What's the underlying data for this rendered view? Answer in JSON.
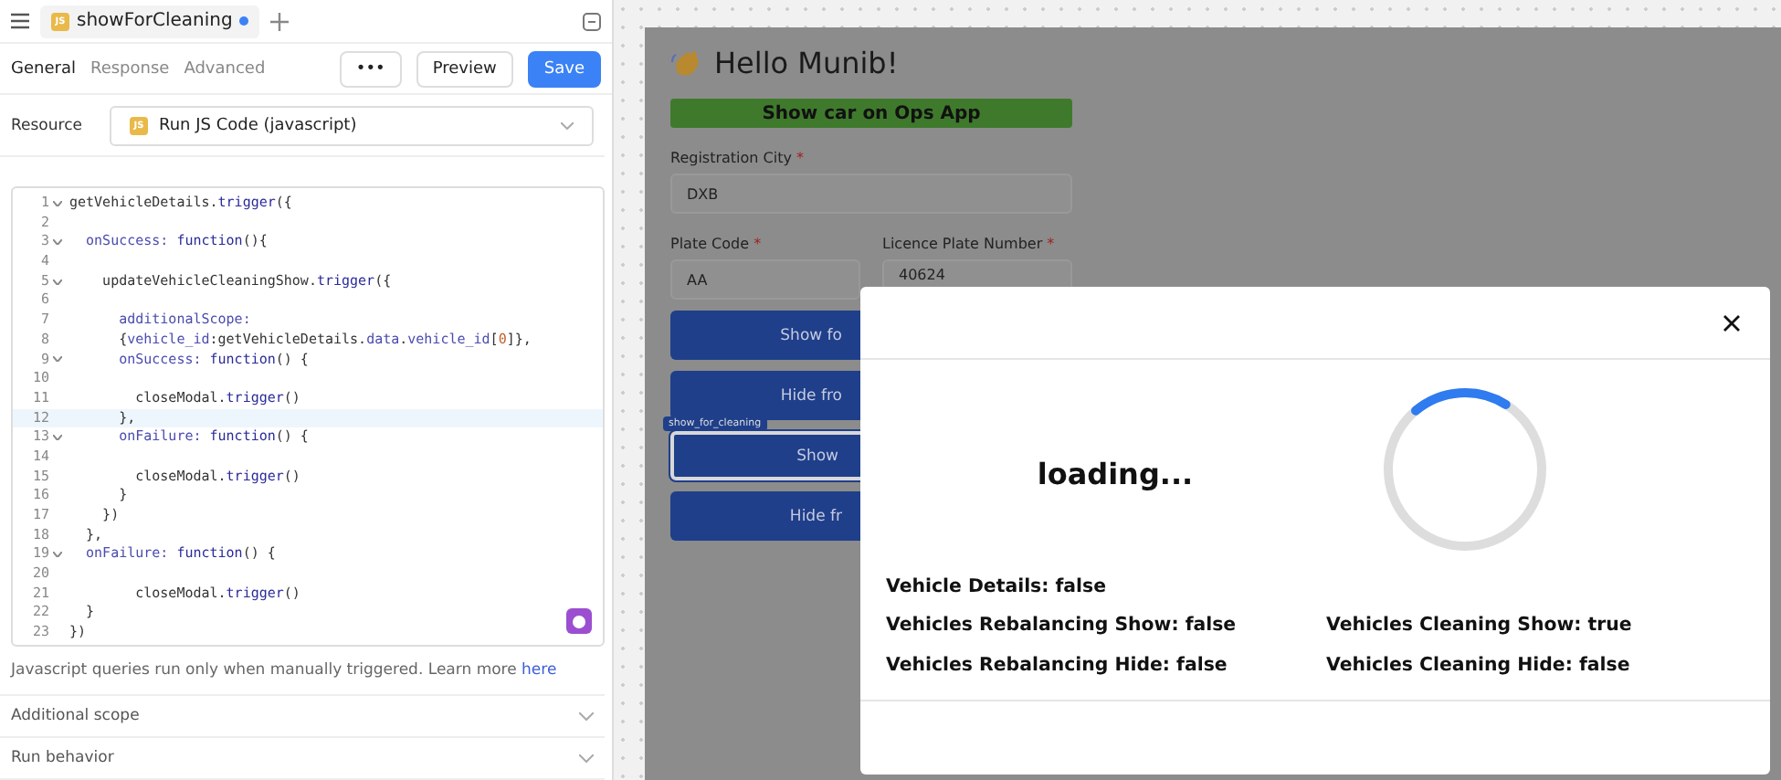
{
  "editor": {
    "tab": {
      "badge": "JS",
      "title": "showForCleaning",
      "unsaved": true
    },
    "subtabs": [
      {
        "label": "General",
        "selected": true
      },
      {
        "label": "Response",
        "selected": false
      },
      {
        "label": "Advanced",
        "selected": false
      }
    ],
    "more_button": "•••",
    "preview_button": "Preview",
    "save_button": "Save",
    "resource": {
      "label": "Resource",
      "badge": "JS",
      "value": "Run JS Code (javascript)"
    },
    "code_lines": [
      {
        "number": "1",
        "foldable": true,
        "selected": false,
        "tokens": [
          {
            "text": "getVehicleDetails.",
            "kind": "ident"
          },
          {
            "text": "trigger",
            "kind": "keyword"
          },
          {
            "text": "({",
            "kind": "ident"
          }
        ]
      },
      {
        "number": "2",
        "foldable": false,
        "selected": false
      },
      {
        "number": "3",
        "foldable": true,
        "selected": false,
        "tokens": [
          {
            "text": "  onSuccess: ",
            "kind": "prop"
          },
          {
            "text": "function",
            "kind": "keyword"
          },
          {
            "text": "(){",
            "kind": "ident"
          }
        ]
      },
      {
        "number": "4",
        "foldable": false,
        "selected": false
      },
      {
        "number": "5",
        "foldable": true,
        "selected": false,
        "tokens": [
          {
            "text": "    updateVehicleCleaningShow.",
            "kind": "ident"
          },
          {
            "text": "trigger",
            "kind": "keyword"
          },
          {
            "text": "({",
            "kind": "ident"
          }
        ]
      },
      {
        "number": "6",
        "foldable": false,
        "selected": false
      },
      {
        "number": "7",
        "foldable": false,
        "selected": false,
        "tokens": [
          {
            "text": "      additionalScope:",
            "kind": "prop"
          }
        ]
      },
      {
        "number": "8",
        "foldable": false,
        "selected": false,
        "tokens": [
          {
            "text": "      {",
            "kind": "ident"
          },
          {
            "text": "vehicle_id",
            "kind": "prop"
          },
          {
            "text": ":getVehicleDetails.",
            "kind": "ident"
          },
          {
            "text": "data",
            "kind": "prop"
          },
          {
            "text": ".",
            "kind": "ident"
          },
          {
            "text": "vehicle_id",
            "kind": "prop"
          },
          {
            "text": "[",
            "kind": "ident"
          },
          {
            "text": "0",
            "kind": "num"
          },
          {
            "text": "]},",
            "kind": "ident"
          }
        ]
      },
      {
        "number": "9",
        "foldable": true,
        "selected": false,
        "tokens": [
          {
            "text": "      onSuccess: ",
            "kind": "prop"
          },
          {
            "text": "function",
            "kind": "keyword"
          },
          {
            "text": "() {",
            "kind": "ident"
          }
        ]
      },
      {
        "number": "10",
        "foldable": false,
        "selected": false
      },
      {
        "number": "11",
        "foldable": false,
        "selected": false,
        "tokens": [
          {
            "text": "        closeModal.",
            "kind": "ident"
          },
          {
            "text": "trigger",
            "kind": "keyword"
          },
          {
            "text": "()",
            "kind": "ident"
          }
        ]
      },
      {
        "number": "12",
        "foldable": false,
        "selected": true,
        "tokens": [
          {
            "text": "      },",
            "kind": "ident"
          }
        ]
      },
      {
        "number": "13",
        "foldable": true,
        "selected": false,
        "tokens": [
          {
            "text": "      onFailure: ",
            "kind": "prop"
          },
          {
            "text": "function",
            "kind": "keyword"
          },
          {
            "text": "() {",
            "kind": "ident"
          }
        ]
      },
      {
        "number": "14",
        "foldable": false,
        "selected": false
      },
      {
        "number": "15",
        "foldable": false,
        "selected": false,
        "tokens": [
          {
            "text": "        closeModal.",
            "kind": "ident"
          },
          {
            "text": "trigger",
            "kind": "keyword"
          },
          {
            "text": "()",
            "kind": "ident"
          }
        ]
      },
      {
        "number": "16",
        "foldable": false,
        "selected": false,
        "tokens": [
          {
            "text": "      }",
            "kind": "ident"
          }
        ]
      },
      {
        "number": "17",
        "foldable": false,
        "selected": false,
        "tokens": [
          {
            "text": "    })",
            "kind": "ident"
          }
        ]
      },
      {
        "number": "18",
        "foldable": false,
        "selected": false,
        "tokens": [
          {
            "text": "  },",
            "kind": "ident"
          }
        ]
      },
      {
        "number": "19",
        "foldable": true,
        "selected": false,
        "tokens": [
          {
            "text": "  onFailure: ",
            "kind": "prop"
          },
          {
            "text": "function",
            "kind": "keyword"
          },
          {
            "text": "() {",
            "kind": "ident"
          }
        ]
      },
      {
        "number": "20",
        "foldable": false,
        "selected": false
      },
      {
        "number": "21",
        "foldable": false,
        "selected": false,
        "tokens": [
          {
            "text": "        closeModal.",
            "kind": "ident"
          },
          {
            "text": "trigger",
            "kind": "keyword"
          },
          {
            "text": "()",
            "kind": "ident"
          }
        ]
      },
      {
        "number": "22",
        "foldable": false,
        "selected": false,
        "tokens": [
          {
            "text": "  }",
            "kind": "ident"
          }
        ]
      },
      {
        "number": "23",
        "foldable": false,
        "selected": false,
        "tokens": [
          {
            "text": "})",
            "kind": "ident"
          }
        ]
      }
    ],
    "hint": "Javascript queries run only when manually triggered. Learn more ",
    "hint_link": "here",
    "sections": [
      {
        "label": "Additional scope",
        "expanded": false
      },
      {
        "label": "Run behavior",
        "expanded": false
      }
    ]
  },
  "app": {
    "greeting": "Hello Munib!",
    "ops_button": "Show car on Ops App",
    "registration_city": {
      "label": "Registration City",
      "required_mark": "*",
      "value": "DXB"
    },
    "plate_code": {
      "label": "Plate Code",
      "required_mark": "*",
      "value": "AA"
    },
    "licence_plate": {
      "label": "Licence Plate Number",
      "required_mark": "*",
      "value": "40624"
    },
    "buttons": [
      {
        "label": "Show fo",
        "selected": false
      },
      {
        "label": "Hide fro",
        "selected": false
      },
      {
        "label": "Show",
        "selected": true,
        "tag": "show_for_cleaning"
      },
      {
        "label": "Hide fr",
        "selected": false
      }
    ]
  },
  "modal": {
    "loading": "loading...",
    "status_rows": [
      {
        "left": "Vehicle Details: false"
      },
      {
        "left": "Vehicles Rebalancing Show: false",
        "right": "Vehicles Cleaning Show: true"
      },
      {
        "left": "Vehicles Rebalancing Hide: false",
        "right": "Vehicles Cleaning Hide: false"
      }
    ]
  }
}
